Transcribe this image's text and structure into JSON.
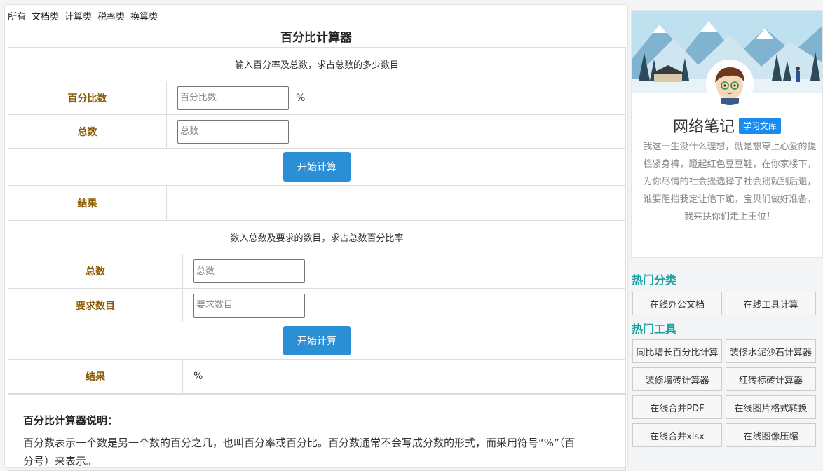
{
  "nav": [
    "所有",
    "文档类",
    "计算类",
    "税率类",
    "换算类"
  ],
  "page_title": "百分比计算器",
  "calc1": {
    "heading": "输入百分率及总数，求占总数的多少数目",
    "field1_label": "百分比数",
    "field1_placeholder": "百分比数",
    "field1_unit": "%",
    "field2_label": "总数",
    "field2_placeholder": "总数",
    "button": "开始计算",
    "result_label": "结果",
    "result_value": ""
  },
  "calc2": {
    "heading": "数入总数及要求的数目，求占总数百分比率",
    "field1_label": "总数",
    "field1_placeholder": "总数",
    "field2_label": "要求数目",
    "field2_placeholder": "要求数目",
    "button": "开始计算",
    "result_label": "结果",
    "result_value": "%"
  },
  "description": {
    "title": "百分比计算器说明：",
    "text": "百分数表示一个数是另一个数的百分之几，也叫百分率或百分比。百分数通常不会写成分数的形式，而采用符号“%”（百分号）来表示。"
  },
  "profile": {
    "name": "网络笔记",
    "badge": "学习文库",
    "motto": "我这一生没什么理想，就是想穿上心爱的提档紧身裤，蹬起红色豆豆鞋，在你家楼下，为你尽情的社会摇选择了社会摇就别后退，谁要阻挡我定让他下跪，宝贝们做好准备，我来扶你们走上王位！"
  },
  "hot_categories": {
    "title": "热门分类",
    "items": [
      "在线办公文档",
      "在线工具计算"
    ]
  },
  "hot_tools": {
    "title": "热门工具",
    "items": [
      "同比增长百分比计算",
      "装修水泥沙石计算器",
      "装修墙砖计算器",
      "红砖标砖计算器",
      "在线合并PDF",
      "在线图片格式转换",
      "在线合并xlsx",
      "在线图像压缩"
    ]
  },
  "colors": {
    "accent_blue": "#2b8fd6",
    "label_brown": "#8a5a00",
    "section_teal": "#1aa0a0",
    "badge_blue": "#1a8cf0"
  }
}
